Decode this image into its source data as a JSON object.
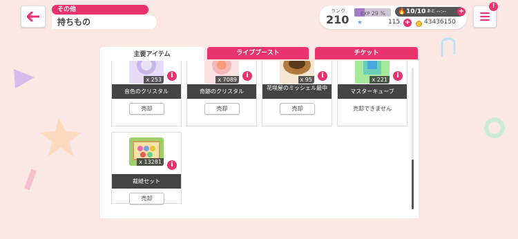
{
  "header": {
    "category": "その他",
    "title": "持ちもの"
  },
  "status": {
    "rank_label": "ランク",
    "rank_value": "210",
    "exp_label": "EXP",
    "exp_percent": "29 %",
    "exp_fraction": 0.29,
    "stamina": "10/10",
    "stamina_sub": "あと",
    "stamina_time": "--:--",
    "star_value": "115",
    "coin_value": "43436150"
  },
  "tabs": [
    {
      "label": "主要アイテム",
      "active": true
    },
    {
      "label": "ライブブースト",
      "active": false
    },
    {
      "label": "チケット",
      "active": false
    }
  ],
  "items": [
    {
      "name": "音色のクリスタル",
      "qty": "x 253",
      "sell": "売却",
      "color": "#c8b6e8"
    },
    {
      "name": "奇跡のクリスタル",
      "qty": "x 7089",
      "sell": "売却",
      "color": "#f4b8b8"
    },
    {
      "name": "花咲屋のミッシェル最中",
      "qty": "x 95",
      "sell": "売却",
      "color": "#b07a3c"
    },
    {
      "name": "マスターキューブ",
      "qty": "x 221",
      "sell": "",
      "unsellable": "売却できません",
      "color": "#6ad0b8"
    },
    {
      "name": "裁縫セット",
      "qty": "x 13281",
      "sell": "売却",
      "color": "#9fcf6a"
    }
  ],
  "colors": {
    "accent": "#e8336d",
    "background": "#fbe7e4",
    "label_bar": "#444444"
  }
}
